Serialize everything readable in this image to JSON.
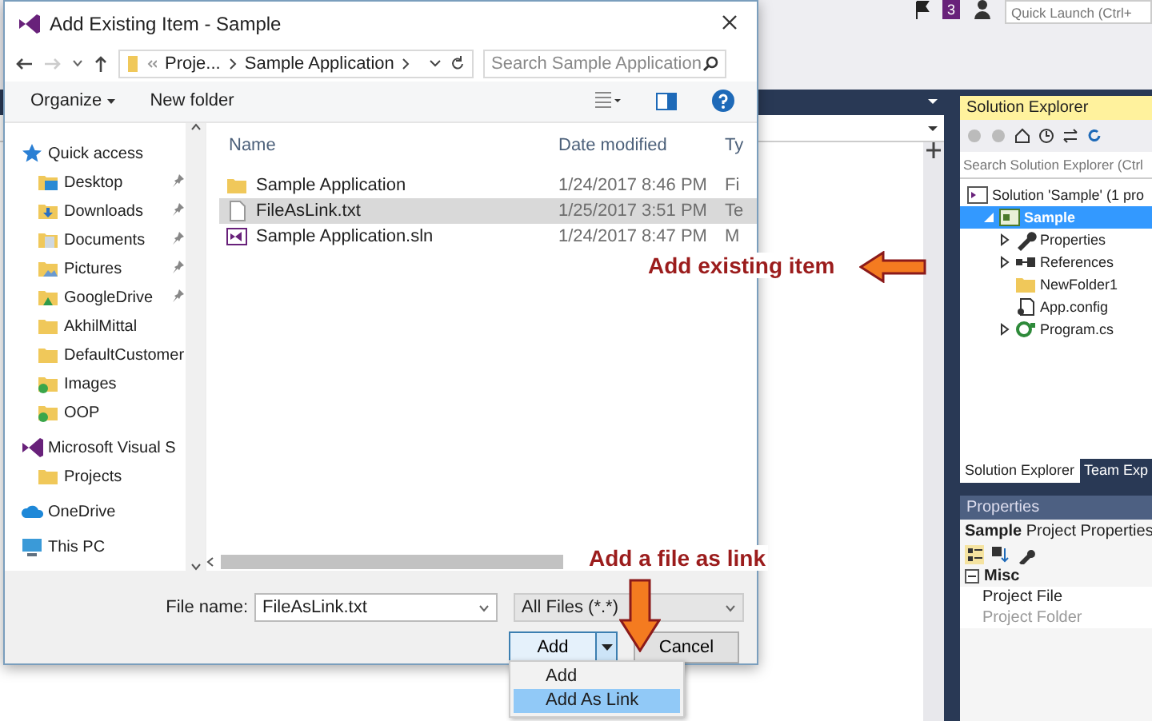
{
  "ide": {
    "notification_count": "3",
    "quick_launch": {
      "placeholder": "Quick Launch (Ctrl+"
    }
  },
  "solution_explorer": {
    "title": "Solution Explorer",
    "search": {
      "placeholder": "Search Solution Explorer (Ctrl"
    },
    "tree": [
      {
        "label": "Solution 'Sample' (1 pro",
        "kind": "solution",
        "selected": false,
        "children": [
          {
            "label": "Sample",
            "kind": "project",
            "selected": true,
            "expanded": true,
            "children": [
              {
                "label": "Properties",
                "kind": "properties",
                "selected": false,
                "expanded": false
              },
              {
                "label": "References",
                "kind": "references",
                "selected": false,
                "expanded": false
              },
              {
                "label": "NewFolder1",
                "kind": "folder",
                "selected": false
              },
              {
                "label": "App.config",
                "kind": "config",
                "selected": false
              },
              {
                "label": "Program.cs",
                "kind": "csharp",
                "selected": false,
                "expanded": false
              }
            ]
          }
        ]
      }
    ]
  },
  "bottom_tabs": [
    {
      "label": "Solution Explorer",
      "selected": true
    },
    {
      "label": "Team Exp",
      "selected": false
    }
  ],
  "properties": {
    "title": "Properties",
    "object_name": "Sample",
    "object_type": "Project Properties",
    "categories": [
      {
        "label": "Misc",
        "expanded": true,
        "rows": [
          {
            "label": "Project File",
            "disabled": false
          },
          {
            "label": "Project Folder",
            "disabled": true
          }
        ]
      }
    ]
  },
  "dialog": {
    "title": "Add Existing Item - Sample",
    "breadcrumb": [
      "Proje...",
      "Sample Application"
    ],
    "search": {
      "placeholder": "Search Sample Application"
    },
    "toolbar": {
      "organize": "Organize",
      "new_folder": "New folder"
    },
    "nav": [
      {
        "label": "Quick access",
        "kind": "star",
        "children": [
          {
            "label": "Desktop",
            "kind": "desktop",
            "pinned": true
          },
          {
            "label": "Downloads",
            "kind": "downloads",
            "pinned": true
          },
          {
            "label": "Documents",
            "kind": "documents",
            "pinned": true
          },
          {
            "label": "Pictures",
            "kind": "pictures",
            "pinned": true
          },
          {
            "label": "GoogleDrive",
            "kind": "drive",
            "pinned": true
          },
          {
            "label": "AkhilMittal",
            "kind": "folder",
            "pinned": false
          },
          {
            "label": "DefaultCustomer",
            "kind": "folder",
            "pinned": false
          },
          {
            "label": "Images",
            "kind": "synced",
            "pinned": false
          },
          {
            "label": "OOP",
            "kind": "synced",
            "pinned": false
          }
        ]
      },
      {
        "label": "Microsoft Visual S",
        "kind": "vs",
        "children": [
          {
            "label": "Projects",
            "kind": "folder",
            "pinned": false
          }
        ]
      },
      {
        "label": "OneDrive",
        "kind": "cloud"
      },
      {
        "label": "This PC",
        "kind": "pc"
      }
    ],
    "columns": [
      "Name",
      "Date modified",
      "Ty"
    ],
    "files": [
      {
        "name": "Sample Application",
        "kind": "folder",
        "date": "1/24/2017 8:46 PM",
        "type": "Fi",
        "selected": false
      },
      {
        "name": "FileAsLink.txt",
        "kind": "text",
        "date": "1/25/2017 3:51 PM",
        "type": "Te",
        "selected": true
      },
      {
        "name": "Sample Application.sln",
        "kind": "solution",
        "date": "1/24/2017 8:47 PM",
        "type": "M",
        "selected": false
      }
    ],
    "file_name": {
      "label": "File name:",
      "value": "FileAsLink.txt"
    },
    "filter": "All Files (*.*)",
    "buttons": {
      "add": "Add",
      "cancel": "Cancel"
    },
    "add_menu": [
      {
        "label": "Add",
        "selected": false
      },
      {
        "label": "Add As Link",
        "selected": true
      }
    ]
  },
  "annotations": [
    {
      "text": "Add existing item",
      "kind": "left"
    },
    {
      "text": "Add a file as link",
      "kind": "down"
    }
  ]
}
